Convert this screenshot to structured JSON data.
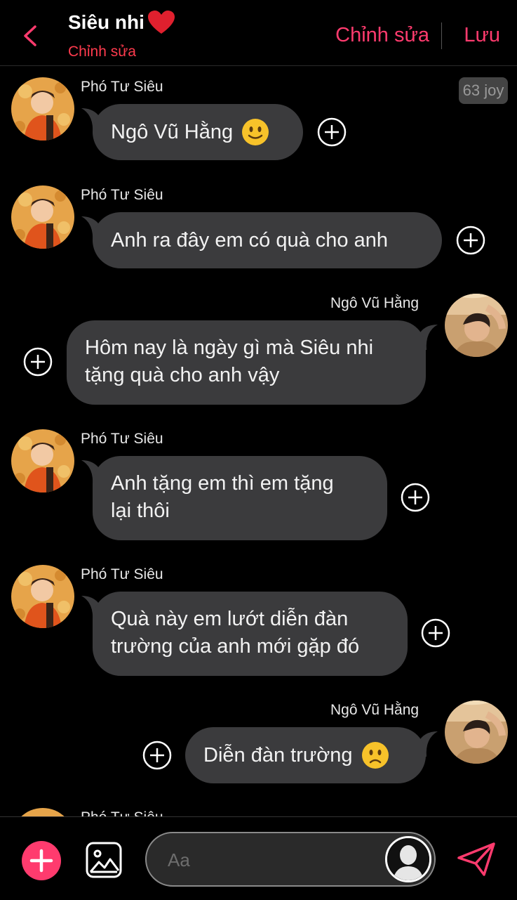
{
  "header": {
    "title": "Siêu nhi",
    "subtitle": "Chỉnh sửa",
    "edit_label": "Chỉnh sửa",
    "save_label": "Lưu",
    "accent_color": "#ff3b6e"
  },
  "badge": "63 joy",
  "messages": [
    {
      "sender": "Phó Tư Siêu",
      "side": "left",
      "text": "Ngô Vũ Hằng",
      "emoji": "slightly-smiling-face"
    },
    {
      "sender": "Phó Tư Siêu",
      "side": "left",
      "text": "Anh ra đây em có quà cho anh"
    },
    {
      "sender": "Ngô Vũ Hằng",
      "side": "right",
      "lines": [
        "Hôm nay là ngày gì mà Siêu nhi",
        "tặng quà cho anh vậy"
      ]
    },
    {
      "sender": "Phó Tư Siêu",
      "side": "left",
      "lines": [
        "Anh tặng em thì em tặng",
        "lại thôi"
      ]
    },
    {
      "sender": "Phó Tư Siêu",
      "side": "left",
      "lines": [
        "Quà này em lướt diễn đàn",
        "trường của anh mới gặp đó"
      ]
    },
    {
      "sender": "Ngô Vũ Hằng",
      "side": "right",
      "text": "Diễn đàn trường",
      "emoji": "frowning-face"
    },
    {
      "sender": "Phó Tư Siêu",
      "side": "left",
      "partial": true
    }
  ],
  "composer": {
    "placeholder": "Aa"
  }
}
